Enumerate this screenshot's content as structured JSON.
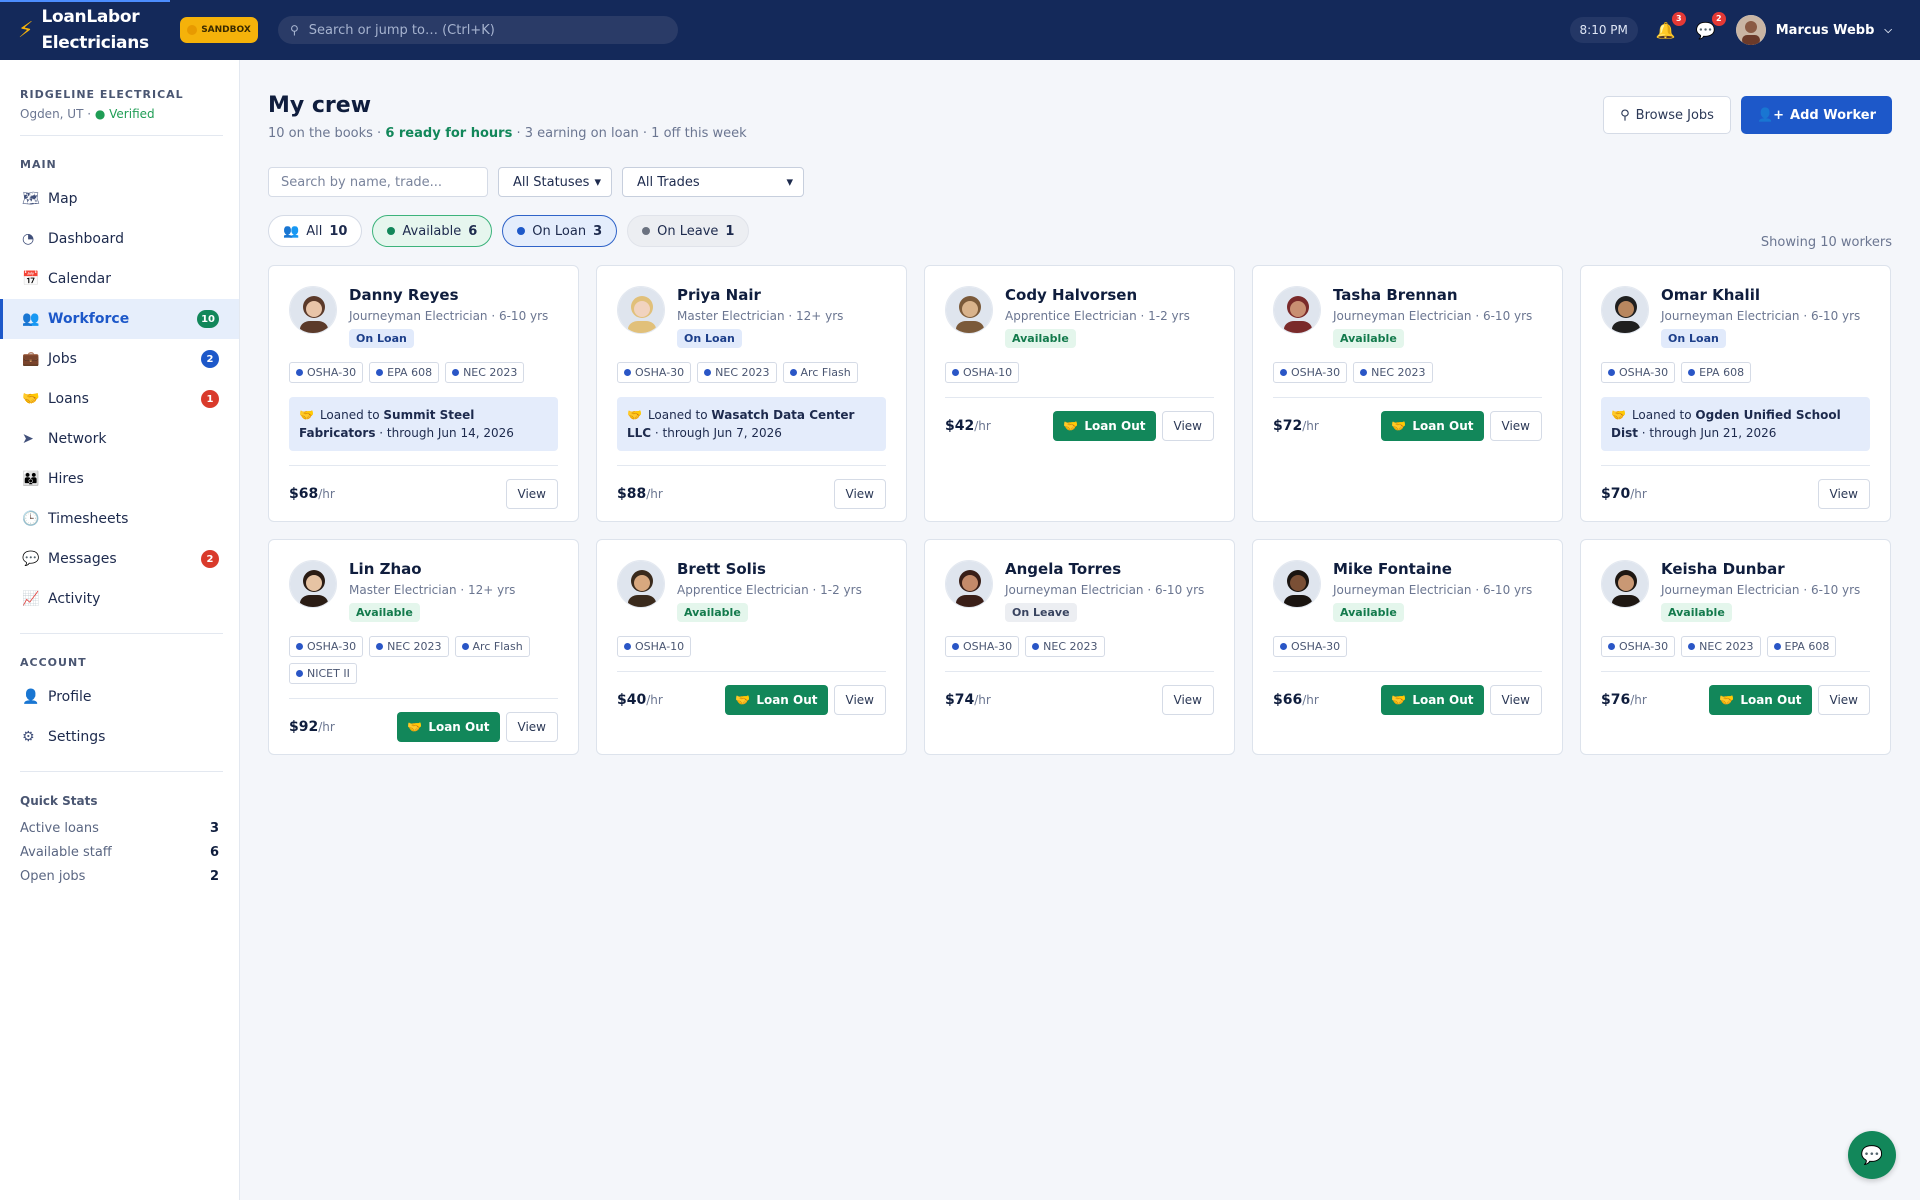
{
  "topbar": {
    "brand_line1": "LoanLabor",
    "brand_line2": "Electricians",
    "sandbox": "SANDBOX",
    "search_placeholder": "Search or jump to…  (Ctrl+K)",
    "time": "8:10 PM",
    "notifications": "3",
    "messages": "2",
    "user_name": "Marcus Webb"
  },
  "org": {
    "name": "RIDGELINE ELECTRICAL",
    "location": "Ogden, UT · ",
    "verified": "● Verified"
  },
  "nav": {
    "main_label": "MAIN",
    "account_label": "ACCOUNT",
    "items": [
      {
        "label": "Map",
        "icon": "map-icon"
      },
      {
        "label": "Dashboard",
        "icon": "dashboard-icon"
      },
      {
        "label": "Calendar",
        "icon": "calendar-icon"
      },
      {
        "label": "Workforce",
        "icon": "workforce-icon",
        "badge": "10"
      },
      {
        "label": "Jobs",
        "icon": "jobs-icon",
        "badge": "2"
      },
      {
        "label": "Loans",
        "icon": "loans-icon",
        "badge": "1"
      },
      {
        "label": "Network",
        "icon": "network-icon"
      },
      {
        "label": "Hires",
        "icon": "hires-icon"
      },
      {
        "label": "Timesheets",
        "icon": "timesheets-icon"
      },
      {
        "label": "Messages",
        "icon": "messages-icon",
        "badge": "2"
      },
      {
        "label": "Activity",
        "icon": "activity-icon"
      }
    ],
    "account_items": [
      {
        "label": "Profile",
        "icon": "profile-icon"
      },
      {
        "label": "Settings",
        "icon": "settings-icon"
      }
    ]
  },
  "quick_stats": {
    "title": "Quick Stats",
    "rows": [
      {
        "label": "Active loans",
        "value": "3"
      },
      {
        "label": "Available staff",
        "value": "6"
      },
      {
        "label": "Open jobs",
        "value": "2"
      }
    ]
  },
  "page": {
    "title": "My crew",
    "sub_a": "10 on the books · ",
    "sub_b": "6 ready for hours",
    "sub_c": " · 3 earning on loan · 1 off this week",
    "browse": "Browse Jobs",
    "add": "Add Worker",
    "search_placeholder": "Search by name, trade...",
    "status_filter": "All Statuses",
    "trade_filter": "All Trades",
    "showing": "Showing 10 workers"
  },
  "chips": [
    {
      "label": "All",
      "count": "10"
    },
    {
      "label": "Available",
      "count": "6"
    },
    {
      "label": "On Loan",
      "count": "3"
    },
    {
      "label": "On Leave",
      "count": "1"
    }
  ],
  "buttons": {
    "loan_out": "Loan Out",
    "view": "View",
    "loaned_to": "Loaned to "
  },
  "workers": [
    {
      "name": "Danny Reyes",
      "role": "Journeyman Electrician · 6-10 yrs",
      "status": "On Loan",
      "certs": [
        "OSHA-30",
        "EPA 608",
        "NEC 2023"
      ],
      "loan_to": "Summit Steel Fabricators",
      "loan_through": " · through Jun 14, 2026",
      "rate": "$68",
      "unit": "/hr"
    },
    {
      "name": "Priya Nair",
      "role": "Master Electrician · 12+ yrs",
      "status": "On Loan",
      "certs": [
        "OSHA-30",
        "NEC 2023",
        "Arc Flash"
      ],
      "loan_to": "Wasatch Data Center LLC",
      "loan_through": " · through Jun 7, 2026",
      "rate": "$88",
      "unit": "/hr"
    },
    {
      "name": "Cody Halvorsen",
      "role": "Apprentice Electrician · 1-2 yrs",
      "status": "Available",
      "certs": [
        "OSHA-10"
      ],
      "rate": "$42",
      "unit": "/hr"
    },
    {
      "name": "Tasha Brennan",
      "role": "Journeyman Electrician · 6-10 yrs",
      "status": "Available",
      "certs": [
        "OSHA-30",
        "NEC 2023"
      ],
      "rate": "$72",
      "unit": "/hr"
    },
    {
      "name": "Omar Khalil",
      "role": "Journeyman Electrician · 6-10 yrs",
      "status": "On Loan",
      "certs": [
        "OSHA-30",
        "EPA 608"
      ],
      "loan_to": "Ogden Unified School Dist",
      "loan_through": " · through Jun 21, 2026",
      "rate": "$70",
      "unit": "/hr"
    },
    {
      "name": "Lin Zhao",
      "role": "Master Electrician · 12+ yrs",
      "status": "Available",
      "certs": [
        "OSHA-30",
        "NEC 2023",
        "Arc Flash",
        "NICET II"
      ],
      "rate": "$92",
      "unit": "/hr"
    },
    {
      "name": "Brett Solis",
      "role": "Apprentice Electrician · 1-2 yrs",
      "status": "Available",
      "certs": [
        "OSHA-10"
      ],
      "rate": "$40",
      "unit": "/hr"
    },
    {
      "name": "Angela Torres",
      "role": "Journeyman Electrician · 6-10 yrs",
      "status": "On Leave",
      "certs": [
        "OSHA-30",
        "NEC 2023"
      ],
      "rate": "$74",
      "unit": "/hr"
    },
    {
      "name": "Mike Fontaine",
      "role": "Journeyman Electrician · 6-10 yrs",
      "status": "Available",
      "certs": [
        "OSHA-30"
      ],
      "rate": "$66",
      "unit": "/hr"
    },
    {
      "name": "Keisha Dunbar",
      "role": "Journeyman Electrician · 6-10 yrs",
      "status": "Available",
      "certs": [
        "OSHA-30",
        "NEC 2023",
        "EPA 608"
      ],
      "rate": "$76",
      "unit": "/hr"
    }
  ]
}
